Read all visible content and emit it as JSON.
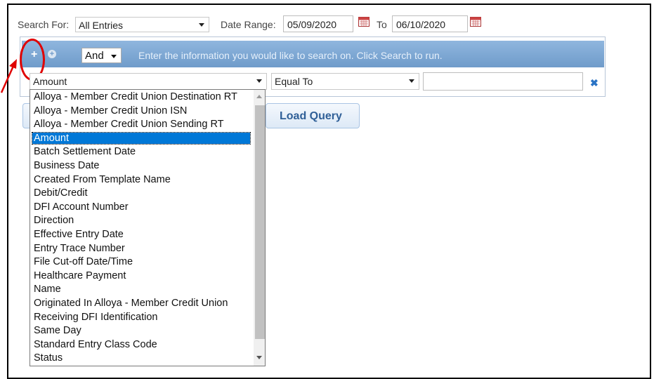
{
  "search": {
    "search_for_label": "Search For:",
    "search_for_value": "All Entries",
    "date_range_label": "Date Range:",
    "date_from": "05/09/2020",
    "to_label": "To",
    "date_to": "06/10/2020"
  },
  "query_bar": {
    "add_icon": "+",
    "add_group_icon": "+",
    "conjunction": "And",
    "message": "Enter the information you would like to search on.  Click Search to run."
  },
  "criteria": {
    "field_value": "Amount",
    "operator_value": "Equal To",
    "value_input": "",
    "remove_icon": "✖"
  },
  "buttons": {
    "load_query": "Load Query"
  },
  "dropdown": {
    "items": [
      "Alloya - Member Credit Union Destination RT",
      "Alloya - Member Credit Union ISN",
      "Alloya - Member Credit Union Sending RT",
      "Amount",
      "Batch Settlement Date",
      "Business Date",
      "Created From Template Name",
      "Debit/Credit",
      "DFI Account Number",
      "Direction",
      "Effective Entry Date",
      "Entry Trace Number",
      "File Cut-off Date/Time",
      "Healthcare Payment",
      "Name",
      "Originated In Alloya - Member Credit Union",
      "Receiving DFI Identification",
      "Same Day",
      "Standard Entry Class Code",
      "Status"
    ],
    "selected": "Amount"
  },
  "colors": {
    "bar": "#7aa6d4",
    "selection": "#0078d7",
    "annotation": "#e00000"
  }
}
